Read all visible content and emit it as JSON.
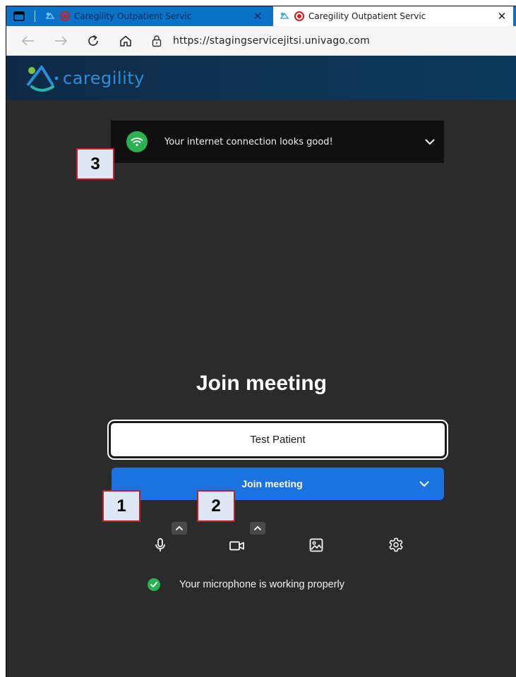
{
  "browser": {
    "tabs": [
      {
        "title": "Caregility Outpatient Servic",
        "close_glyph": "✕",
        "state": "inactive"
      },
      {
        "title": "Caregility Outpatient Servic",
        "close_glyph": "✕",
        "state": "active"
      }
    ],
    "url": "https://stagingservicejitsi.univago.com",
    "icons": [
      "tab-actions-icon",
      "back-icon",
      "forward-icon",
      "refresh-icon",
      "home-icon",
      "lock-icon",
      "recording-icon"
    ]
  },
  "app": {
    "brand": "caregility",
    "header_color": "#0f3251",
    "accent_color": "#1a73e0",
    "success_color": "#2bb152"
  },
  "connection_notice": {
    "text": "Your internet connection looks good!",
    "icon": "wifi-icon"
  },
  "prejoin": {
    "title": "Join meeting",
    "name_value": "Test Patient",
    "join_button_label": "Join meeting",
    "toolbar_icons": [
      "microphone-icon",
      "camera-icon",
      "background-image-icon",
      "settings-icon"
    ],
    "status_text": "Your microphone is working properly"
  },
  "callouts": [
    "1",
    "2",
    "3"
  ]
}
